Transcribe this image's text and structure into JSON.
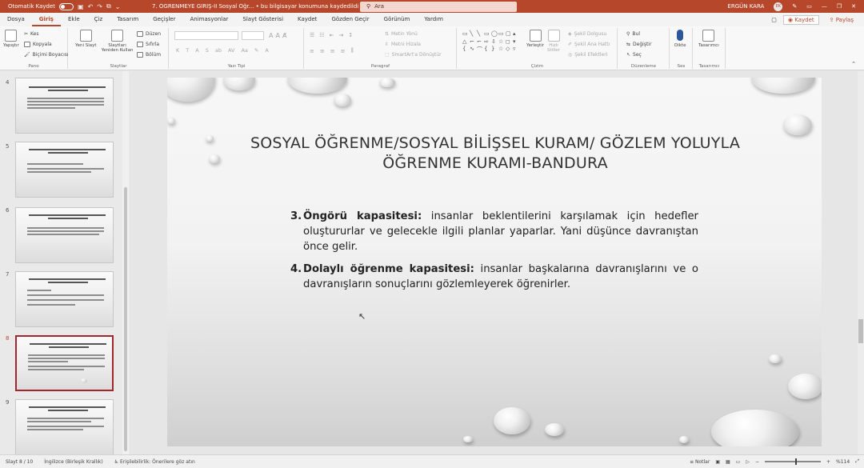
{
  "titlebar": {
    "autosave_label": "Otomatik Kaydet",
    "doc_title": "7. ÖĞRENMEYE GİRİŞ-II Sosyal Öğr...",
    "save_status": "bu bilgisayar konumuna kaydedildi",
    "search_placeholder": "Ara",
    "user_name": "ERGÜN KARA",
    "user_initials": "EK"
  },
  "menu": {
    "tabs": [
      "Dosya",
      "Giriş",
      "Ekle",
      "Çiz",
      "Tasarım",
      "Geçişler",
      "Animasyonlar",
      "Slayt Gösterisi",
      "Kaydet",
      "Gözden Geçir",
      "Görünüm",
      "Yardım"
    ],
    "active_tab": "Giriş",
    "save_button": "Kaydet",
    "share_button": "Paylaş"
  },
  "ribbon": {
    "clipboard": {
      "paste": "Yapıştır",
      "cut": "Kes",
      "copy": "Kopyala",
      "format_painter": "Biçimi Boyacısı",
      "label": "Pano"
    },
    "slides": {
      "new_slide": "Yeni Slayt",
      "reuse": "Slaytları Yeniden Kullan",
      "layout": "Düzen",
      "reset": "Sıfırla",
      "section": "Bölüm",
      "label": "Slaytlar"
    },
    "font": {
      "label": "Yazı Tipi",
      "bold": "K",
      "italic": "T",
      "underline": "A",
      "strike": "S",
      "abc": "ab",
      "size_up": "A",
      "size_down": "A",
      "aa": "Aa"
    },
    "paragraph": {
      "label": "Paragraf",
      "text_direction": "Metin Yönü",
      "align_text": "Metni Hizala",
      "smartart": "SmartArt'a Dönüştür"
    },
    "drawing": {
      "arrange": "Yerleştir",
      "quick_styles": "Hızlı Stiller",
      "shape_fill": "Şekil Dolgusu",
      "shape_outline": "Şekil Ana Hattı",
      "shape_effects": "Şekil Efektleri",
      "label": "Çizim"
    },
    "editing": {
      "find": "Bul",
      "replace": "Değiştir",
      "select": "Seç",
      "label": "Düzenleme"
    },
    "voice": {
      "dictate": "Dikte",
      "label": "Ses"
    },
    "designer": {
      "designer": "Tasarımcı",
      "label": "Tasarımcı"
    }
  },
  "thumbnails": {
    "numbers": [
      "4",
      "5",
      "6",
      "7",
      "8",
      "9"
    ],
    "selected": "8"
  },
  "slide": {
    "title_line1": "SOSYAL ÖĞRENME/SOSYAL BİLİŞSEL KURAM/ GÖZLEM YOLUYLA",
    "title_line2": "ÖĞRENME KURAMI-BANDURA",
    "items": [
      {
        "num": "3.",
        "term": "Öngörü kapasitesi:",
        "text": "insanlar beklentilerini karşılamak için hedefler oluştururlar ve gelecekle ilgili planlar yaparlar. Yani düşünce davranıştan önce gelir."
      },
      {
        "num": "4.",
        "term": "Dolaylı öğrenme kapasitesi:",
        "text": "insanlar başkalarına davranışlarını ve o davranışların sonuçlarını gözlemleyerek öğrenirler."
      }
    ]
  },
  "statusbar": {
    "slide_info": "Slayt 8 / 10",
    "language": "İngilizce (Birleşik Krallık)",
    "accessibility": "Erişilebilirlik: Önerilere göz atın",
    "notes": "Notlar",
    "zoom": "%114"
  }
}
